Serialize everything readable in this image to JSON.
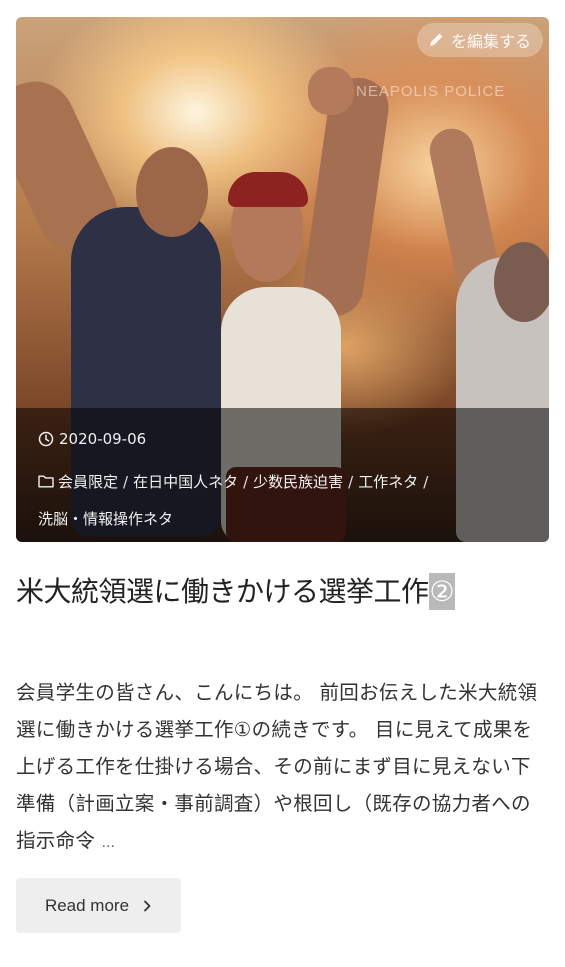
{
  "post": {
    "edit_label": "を編集する",
    "date": "2020-09-06",
    "categories": [
      "会員限定",
      "在日中国人ネタ",
      "少数民族迫害",
      "工作ネタ",
      "洗脳・情報操作ネタ"
    ],
    "category_separator": "/",
    "title_main": "米大統領選に働きかける選挙工作",
    "title_mark": "②",
    "excerpt": "会員学生の皆さん、こんにちは。 前回お伝えした米大統領選に働きかける選挙工作①の続きです。 目に見えて成果を上げる工作を仕掛ける場合、その前にまず目に見えない下準備（計画立案・事前調査）や根回し（既存の協力者への指示命令",
    "excerpt_ellipsis": "...",
    "read_more_label": "Read more",
    "photo_sign_text": "NEAPOLIS POLICE"
  },
  "icons": {
    "edit": "pencil-icon",
    "date": "clock-icon",
    "category": "folder-icon",
    "read_more": "chevron-right-icon"
  }
}
